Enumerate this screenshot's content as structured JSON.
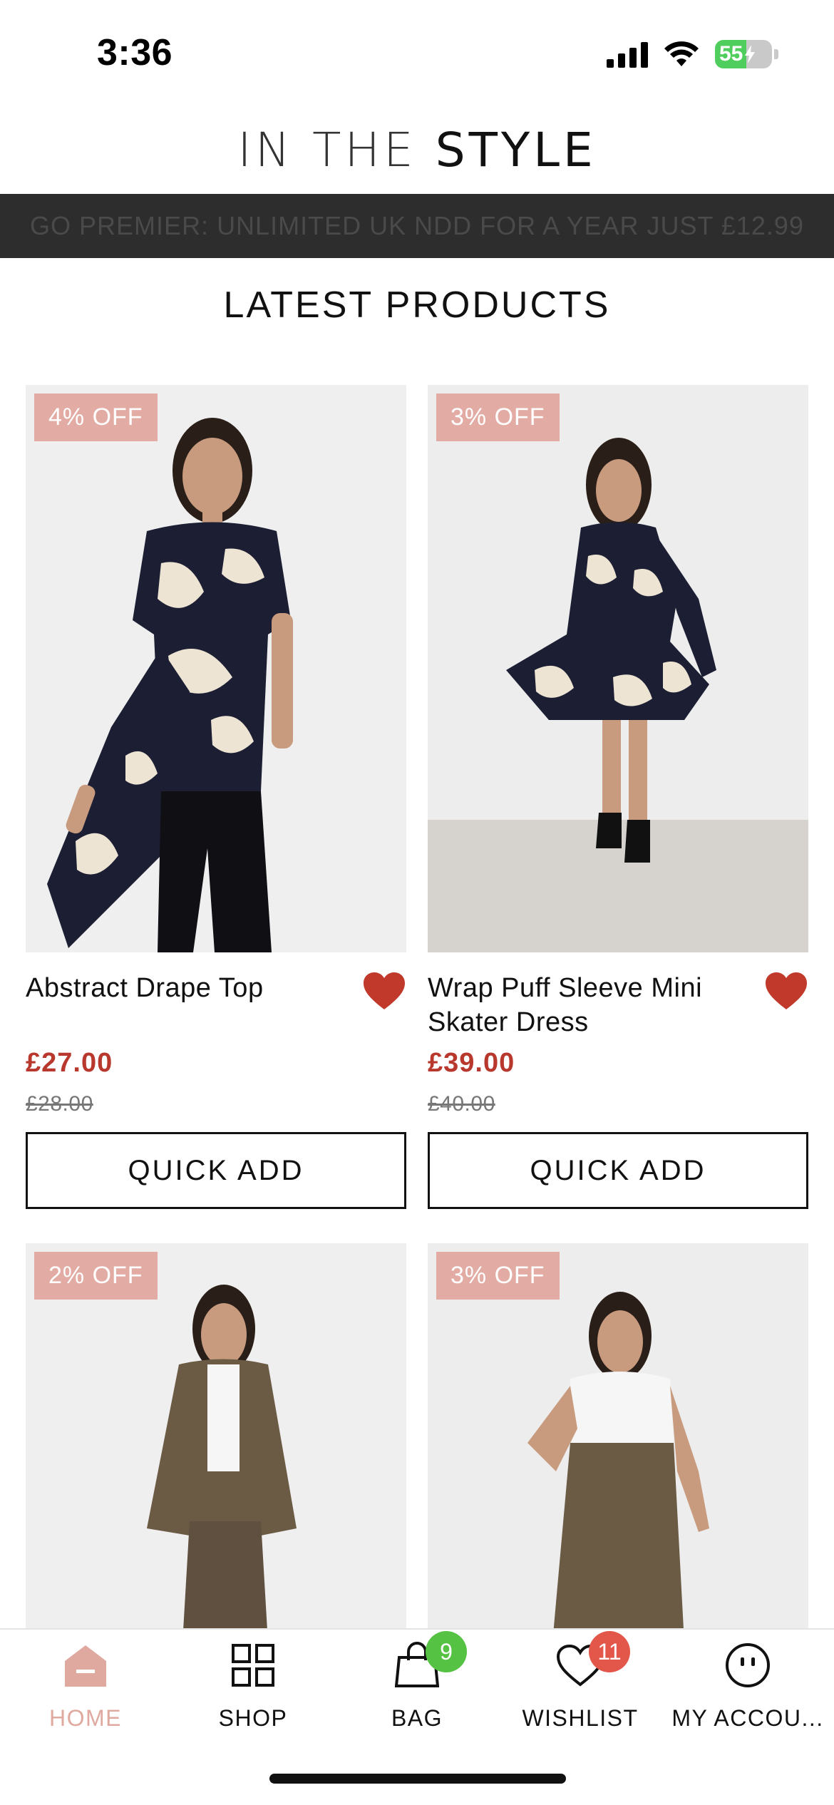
{
  "status_bar": {
    "time": "3:36",
    "battery": "55",
    "battery_level_percent": 55
  },
  "header": {
    "logo_part1": "IN THE",
    "logo_part2": "STYLE"
  },
  "promo": {
    "text": "GO PREMIER: UNLIMITED UK NDD FOR A YEAR JUST £12.99"
  },
  "section": {
    "title": "LATEST PRODUCTS"
  },
  "products": [
    {
      "badge": "4% OFF",
      "name": "Abstract Drape Top",
      "price": "£27.00",
      "old_price": "£28.00",
      "button": "QUICK ADD",
      "wishlisted": true
    },
    {
      "badge": "3% OFF",
      "name": "Wrap Puff Sleeve Mini Skater Dress",
      "price": "£39.00",
      "old_price": "£40.00",
      "button": "QUICK ADD",
      "wishlisted": true
    },
    {
      "badge": "2% OFF"
    },
    {
      "badge": "3% OFF"
    }
  ],
  "tabbar": {
    "items": [
      {
        "label": "HOME",
        "icon": "home-icon",
        "active": true
      },
      {
        "label": "SHOP",
        "icon": "grid-icon"
      },
      {
        "label": "BAG",
        "icon": "bag-icon",
        "count": "9"
      },
      {
        "label": "WISHLIST",
        "icon": "heart-icon",
        "count": "11"
      },
      {
        "label": "MY ACCOU...",
        "icon": "account-icon"
      }
    ]
  },
  "colors": {
    "accent": "#e0a99f",
    "sale_price": "#b8382d",
    "badge_bg": "#e2aca4",
    "promo_bg": "#2d2d2d",
    "bag_badge": "#55c244",
    "wishlist_badge": "#e2574a"
  }
}
